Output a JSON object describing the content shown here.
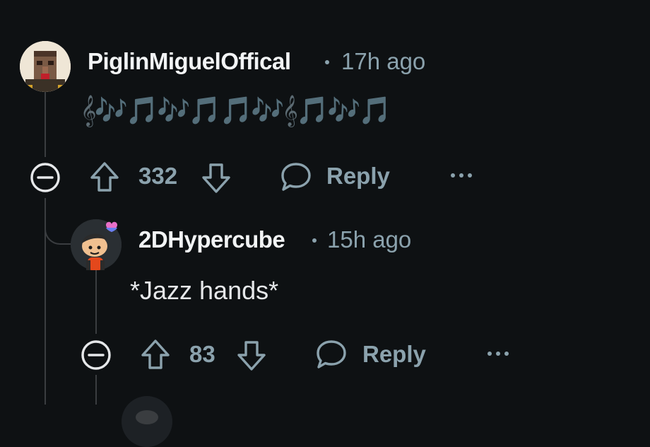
{
  "colors": {
    "background": "#0e1113",
    "meta_text": "#8ba2ad",
    "thread_line": "#3a3d40",
    "author_text": "#f2f4f5"
  },
  "comments": [
    {
      "author": "PiglinMiguelOffical",
      "time": "17h ago",
      "body": "𝄞🎶🎵🎶🎵🎵🎶𝄞🎵🎶🎵",
      "upvotes": "332",
      "reply_label": "Reply",
      "avatar_icon": "blocky-character-avatar-icon"
    },
    {
      "author": "2DHypercube",
      "time": "15h ago",
      "body": "*Jazz hands*",
      "upvotes": "83",
      "reply_label": "Reply",
      "avatar_icon": "snoo-avatar-icon"
    }
  ]
}
